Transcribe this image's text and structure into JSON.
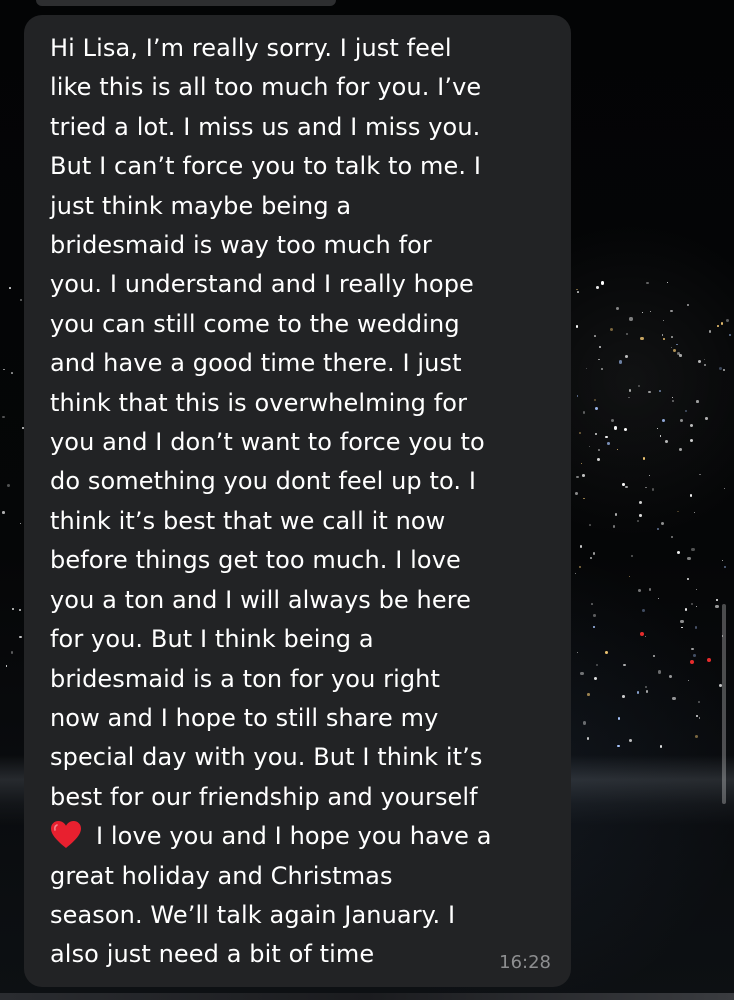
{
  "message": {
    "lines": [
      "Hi Lisa, I’m really sorry. I just feel",
      "like this is all too much for you. I’ve",
      "tried a lot. I miss us and I miss you.",
      "But I can’t force you to talk to me. I",
      "just think maybe being a",
      "bridesmaid is way too much for",
      "you. I understand and I really hope",
      "you can still come to the wedding",
      "and have a good time there. I just",
      "think that this is overwhelming for",
      "you and I don’t want to force you to",
      "do something you dont feel up to. I",
      "think it’s best that we call it now",
      "before things get too much. I love",
      "you a ton and I will always be here",
      "for you. But I think being a",
      "bridesmaid is a ton for you right",
      "now and I hope to still share my",
      "special day with you. But I think it’s",
      "best for our friendship and yourself"
    ],
    "heart_line": "I love you and I hope you have a",
    "heart_icon": "red-heart-emoji",
    "heart_color": "#e8202f",
    "closing_lines": [
      "great holiday and Christmas",
      "season. We’ll talk again January. I",
      "also just need a bit of time"
    ],
    "timestamp": "16:28"
  },
  "colors": {
    "bubble": "#222325",
    "text": "#ffffff",
    "timestamp": "#8d8e90",
    "background": "#050607"
  }
}
